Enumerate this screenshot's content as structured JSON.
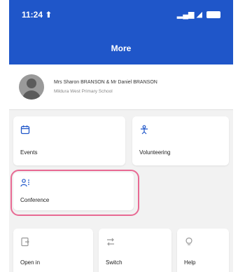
{
  "status": {
    "time": "11:24 ⬆",
    "signal": "▂▄▆ ◢"
  },
  "header": {
    "title": "More"
  },
  "profile": {
    "name": "Mrs Sharon BRANSON & Mr Daniel BRANSON",
    "school": "Mildura West Primary School"
  },
  "tiles": {
    "events": "Events",
    "volunteering": "Volunteering",
    "conference": "Conference",
    "open": "Open in",
    "switch": "Switch",
    "help": "Help"
  }
}
